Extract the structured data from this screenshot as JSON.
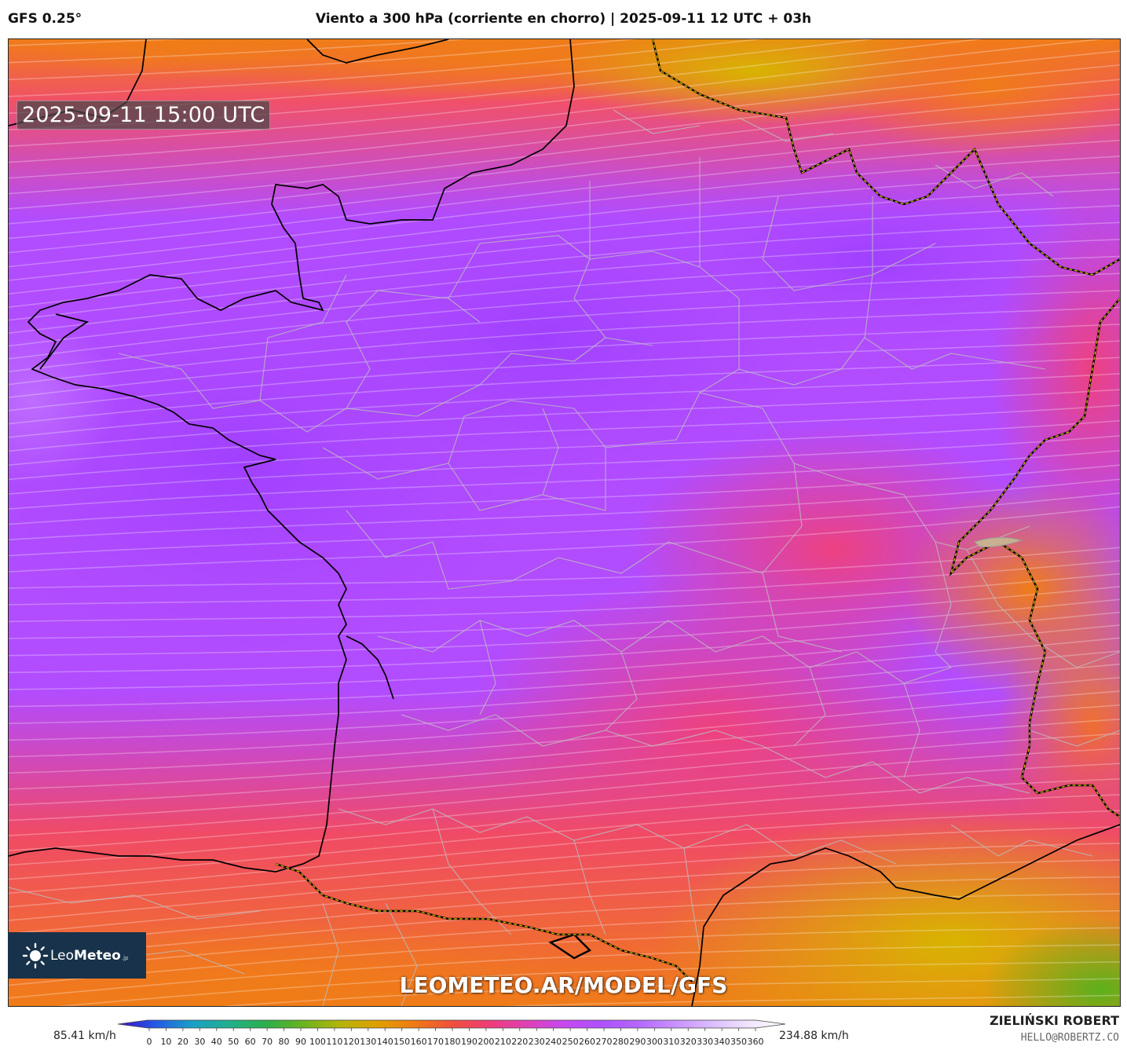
{
  "header": {
    "model": "GFS 0.25°",
    "title": "Viento a 300 hPa (corriente en chorro) | 2025-09-11 12 UTC + 03h"
  },
  "map": {
    "valid_time": "2025-09-11 15:00 UTC",
    "watermark": "LEOMETEO.AR/MODEL/GFS",
    "logo": {
      "name_light": "Leo",
      "name_bold": "Meteo",
      "suffix": ".jp"
    }
  },
  "legend": {
    "min_label": "85.41 km/h",
    "max_label": "234.88 km/h",
    "ticks": [
      "0",
      "10",
      "20",
      "30",
      "40",
      "50",
      "60",
      "70",
      "80",
      "90",
      "100",
      "110",
      "120",
      "130",
      "140",
      "150",
      "160",
      "170",
      "180",
      "190",
      "200",
      "210",
      "220",
      "230",
      "240",
      "250",
      "260",
      "270",
      "280",
      "290",
      "300",
      "310",
      "320",
      "330",
      "340",
      "350",
      "360"
    ],
    "colors": [
      "#3a10c8",
      "#2458e6",
      "#18a0c8",
      "#22b08c",
      "#2bb04a",
      "#6ab41e",
      "#b4b40a",
      "#e0a000",
      "#f07a14",
      "#f0503c",
      "#f03c78",
      "#e040b4",
      "#c848f0",
      "#b050ff",
      "#b466ff",
      "#c890ff",
      "#dcbcff",
      "#f0e4ff",
      "#ffffff"
    ]
  },
  "credit": {
    "name": "ZIELIŃSKI ROBERT",
    "email": "HELLO@ROBERTZ.CO"
  }
}
